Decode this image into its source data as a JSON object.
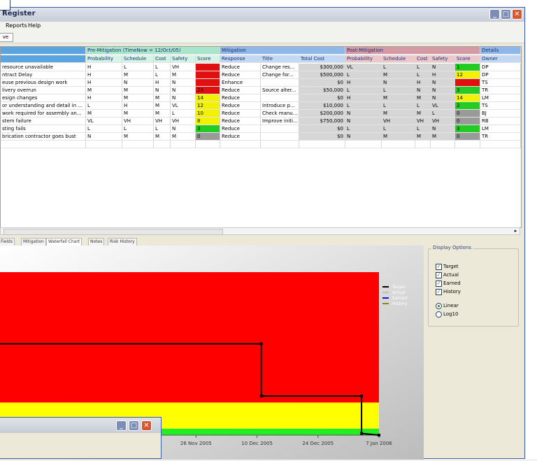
{
  "window": {
    "title": "Register"
  },
  "menu": [
    {
      "label": "Reports"
    },
    {
      "label": "Help"
    }
  ],
  "toolbar": {
    "save_label": "ve"
  },
  "grid": {
    "groups": [
      {
        "label": "",
        "color": "#5aa4e0"
      },
      {
        "label": "Pre-Mitigation (TimeNow = 12/Oct/05)",
        "color": "#a8e6cc"
      },
      {
        "label": "Mitigation",
        "color": "#8fb8ea"
      },
      {
        "label": "Post-Mitigation",
        "color": "#d49aa4"
      },
      {
        "label": "Details",
        "color": "#8fb8ea"
      }
    ],
    "columns": [
      "",
      "Probability",
      "Schedule",
      "Cost",
      "Safety",
      "Score",
      "Response",
      "Title",
      "Total Cost",
      "Probability",
      "Schedule",
      "Cost",
      "Safety",
      "Score",
      "Owner"
    ],
    "rows": [
      [
        "resource unavailable",
        "H",
        "L",
        "L",
        "VH",
        "",
        "Reduce",
        "Change res...",
        "$300,000",
        "VL",
        "L",
        "L",
        "N",
        "1",
        "DP"
      ],
      [
        "ntract Delay",
        "H",
        "M",
        "L",
        "M",
        "",
        "Reduce",
        "Change for...",
        "$500,000",
        "L",
        "M",
        "L",
        "H",
        "12",
        "DP"
      ],
      [
        "euse previous design work",
        "H",
        "N",
        "H",
        "N",
        "",
        "Enhance",
        "",
        "$0",
        "H",
        "N",
        "H",
        "N",
        "",
        "TS"
      ],
      [
        "livery overrun",
        "M",
        "M",
        "N",
        "N",
        "20",
        "Reduce",
        "Source alter...",
        "$50,000",
        "L",
        "L",
        "N",
        "N",
        "3",
        "TR"
      ],
      [
        "esign changes",
        "H",
        "M",
        "M",
        "N",
        "14",
        "Reduce",
        "",
        "$0",
        "H",
        "M",
        "M",
        "N",
        "14",
        "LM"
      ],
      [
        "or understanding and detail in ...",
        "L",
        "H",
        "M",
        "VL",
        "12",
        "Reduce",
        "Introduce p...",
        "$10,000",
        "L",
        "L",
        "L",
        "VL",
        "2",
        "TS"
      ],
      [
        "work required for assembly an...",
        "M",
        "M",
        "M",
        "L",
        "10",
        "Reduce",
        "Check manu...",
        "$200,000",
        "N",
        "M",
        "M",
        "L",
        "0",
        "BJ"
      ],
      [
        "stem failure",
        "VL",
        "VH",
        "VH",
        "VH",
        "8",
        "Reduce",
        "Improve initi...",
        "$750,000",
        "N",
        "VH",
        "VH",
        "VH",
        "0",
        "RB"
      ],
      [
        "sting fails",
        "L",
        "L",
        "L",
        "N",
        "3",
        "Reduce",
        "",
        "$0",
        "L",
        "L",
        "L",
        "N",
        "3",
        "LM"
      ],
      [
        "brication contractor goes bust",
        "N",
        "M",
        "M",
        "M",
        "0",
        "Reduce",
        "",
        "$0",
        "N",
        "M",
        "M",
        "M",
        "0",
        "TR"
      ]
    ],
    "score_colors": {
      "red": "#e01010",
      "yellow": "#f2f200",
      "green": "#22cc22",
      "gray": "#9a9a9a"
    }
  },
  "tabs": [
    {
      "label": "Fields"
    },
    {
      "label": "Mitigation"
    },
    {
      "label": "Waterfall Chart"
    },
    {
      "label": "Notes"
    },
    {
      "label": "Risk History"
    }
  ],
  "display_options": {
    "title": "Display Options",
    "checks": [
      {
        "label": "Target"
      },
      {
        "label": "Actual"
      },
      {
        "label": "Earned"
      },
      {
        "label": "History"
      }
    ],
    "radios": [
      {
        "label": "Linear",
        "on": true
      },
      {
        "label": "Log10",
        "on": false
      }
    ]
  },
  "chart_data": {
    "type": "line",
    "title": "",
    "xlabel": "",
    "ylabel": "",
    "x_ticks": [
      "26 Nov 2005",
      "10 Dec 2005",
      "24 Dec 2005",
      "7 Jan 2006"
    ],
    "x_range": [
      "2005-10-12",
      "2006-01-07"
    ],
    "y_range": [
      0,
      100
    ],
    "bands": [
      {
        "from": 0,
        "to": 4,
        "color": "#22ee22"
      },
      {
        "from": 4,
        "to": 20,
        "color": "#ffff00"
      },
      {
        "from": 20,
        "to": 100,
        "color": "#ff0000"
      }
    ],
    "legend_placement": "top-right",
    "series": [
      {
        "name": "Target",
        "color": "#000000",
        "x": [
          "2005-10-12",
          "2005-12-11",
          "2005-12-11",
          "2006-01-03",
          "2006-01-03",
          "2006-01-07"
        ],
        "y": [
          56,
          56,
          24,
          24,
          1,
          0
        ]
      },
      {
        "name": "Actual",
        "color": "#bfbfbf",
        "x": [],
        "y": []
      },
      {
        "name": "Earned",
        "color": "#1010ee",
        "x": [],
        "y": []
      },
      {
        "name": "History",
        "color": "#8a8a00",
        "x": [],
        "y": []
      }
    ]
  }
}
